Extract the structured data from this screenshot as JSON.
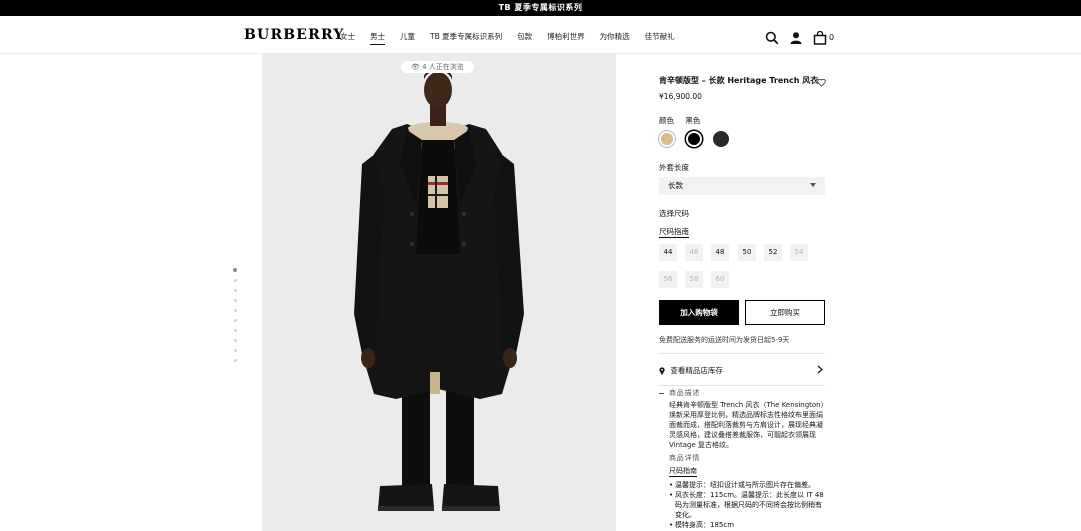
{
  "promo": {
    "text": "TB 夏季专属标识系列"
  },
  "header": {
    "logo": "BURBERRY",
    "nav": [
      "女士",
      "男士",
      "儿童",
      "TB 夏季专属标识系列",
      "包款",
      "博柏利世界",
      "为你精选",
      "佳节献礼"
    ],
    "active_nav": "男士",
    "icons": [
      "search-icon",
      "account-icon",
      "bag-icon"
    ],
    "cart_count": "0"
  },
  "gallery": {
    "viewers": "4 人正在浏览",
    "thumbnail_count": 10,
    "active_thumbnail": 1
  },
  "product": {
    "title": "肯辛顿版型 – 长款 Heritage Trench 风衣",
    "price": "¥16,900.00",
    "color_label": "颜色",
    "color_value": "黑色",
    "swatches": [
      {
        "name": "honey",
        "color": "#d9bb8c",
        "selected": false
      },
      {
        "name": "black",
        "color": "#000000",
        "selected": true
      },
      {
        "name": "midnight",
        "color": "#2a2a2a",
        "selected": false
      }
    ],
    "length_label": "外套长度",
    "length_value": "长款",
    "size_label": "选择尺码",
    "size_guide": "尺码指南",
    "sizes": [
      {
        "label": "44",
        "available": true
      },
      {
        "label": "46",
        "available": false
      },
      {
        "label": "48",
        "available": true
      },
      {
        "label": "50",
        "available": true
      },
      {
        "label": "52",
        "available": true
      },
      {
        "label": "54",
        "available": false
      },
      {
        "label": "56",
        "available": false
      },
      {
        "label": "58",
        "available": false
      },
      {
        "label": "60",
        "available": false
      }
    ],
    "add_to_bag": "加入购物袋",
    "buy_now": "立即购买",
    "shipping": "免费配送服务的运送时间为发货日起5-9天",
    "store_stock": "查看精品店库存"
  },
  "description": {
    "heading": "商品描述",
    "text": "经典肯辛顿版型 Trench 风衣（The Kensington）焕新采用厚登比例，精选品牌标志性格纹布里面绢面裁而成，搭配利落裁剪与方肩设计，展现经典凝灵感风格，建议叠搭差裁服饰，可靓起衣领展现 Vintage 复古格纹。",
    "details_heading": "商品详情",
    "size_guide": "尺码指南",
    "bullets": [
      "温馨提示：纽扣设计或与所示图片存在偏差。",
      "风衣长度：115cm。温馨提示：此长度以 IT 48 码为测量标准，根据尺码的不同将会按比例稍有变化。",
      "模特身高：185cm"
    ]
  }
}
